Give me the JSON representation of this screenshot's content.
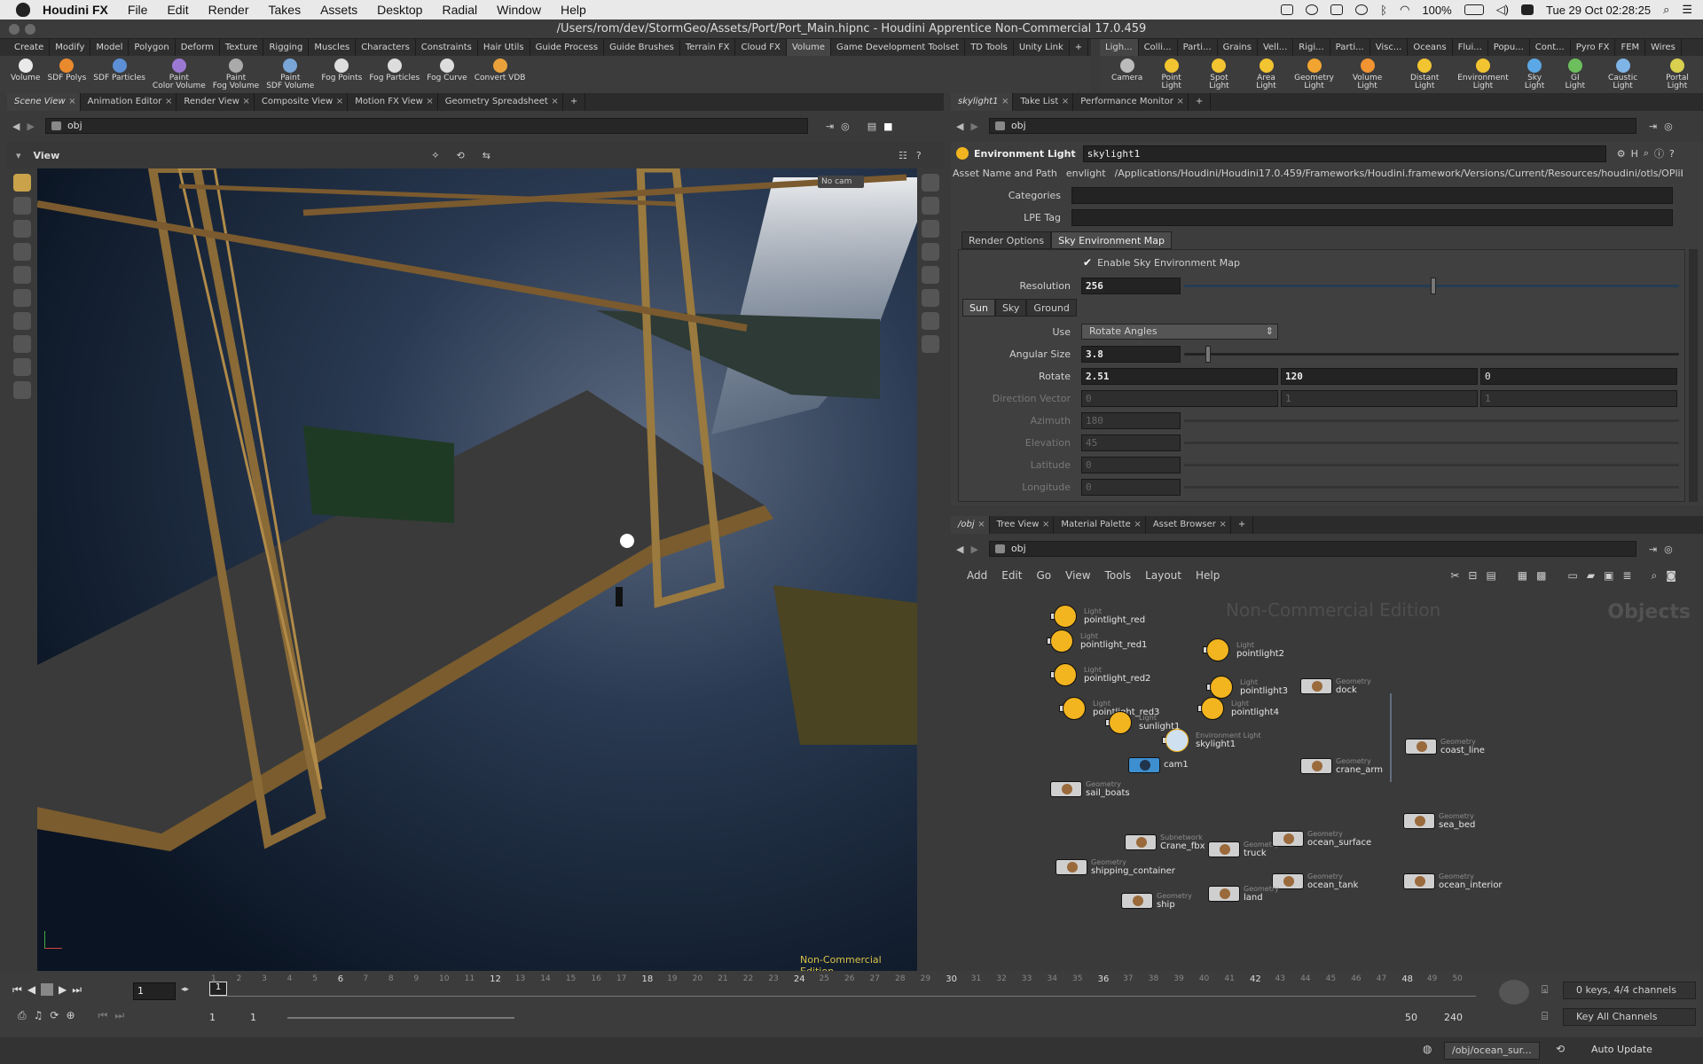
{
  "menubar": {
    "app": "Houdini FX",
    "items": [
      "File",
      "Edit",
      "Render",
      "Takes",
      "Assets",
      "Desktop",
      "Radial",
      "Window",
      "Help"
    ],
    "battery": "100%",
    "datetime": "Tue 29 Oct  02:28:25"
  },
  "window": {
    "title": "/Users/rom/dev/StormGeo/Assets/Port/Port_Main.hipnc - Houdini Apprentice Non-Commercial 17.0.459"
  },
  "shelf": {
    "tabs": [
      "Create",
      "Modify",
      "Model",
      "Polygon",
      "Deform",
      "Texture",
      "Rigging",
      "Muscles",
      "Characters",
      "Constraints",
      "Hair Utils",
      "Guide Process",
      "Guide Brushes",
      "Terrain FX",
      "Cloud FX",
      "Volume",
      "Game Development Toolset",
      "TD Tools",
      "Unity Link",
      "+"
    ],
    "active_tab": "Volume",
    "tools": [
      {
        "label": "Volume",
        "color": "#e9e9e9"
      },
      {
        "label": "SDF Polys",
        "color": "#e98a2e"
      },
      {
        "label": "SDF Particles",
        "color": "#5c8fd6"
      },
      {
        "label": "Paint\nColor Volume",
        "color": "#9b79d3"
      },
      {
        "label": "Paint\nFog Volume",
        "color": "#aaaaaa"
      },
      {
        "label": "Paint\nSDF Volume",
        "color": "#79a6d6"
      },
      {
        "label": "Fog Points",
        "color": "#dddddd"
      },
      {
        "label": "Fog Particles",
        "color": "#dddddd"
      },
      {
        "label": "Fog Curve",
        "color": "#dddddd"
      },
      {
        "label": "Convert VDB",
        "color": "#e9a23b"
      }
    ]
  },
  "light_shelf": {
    "tabs": [
      "Ligh...",
      "Colli...",
      "Parti...",
      "Grains",
      "Vell...",
      "Rigi...",
      "Parti...",
      "Visc...",
      "Oceans",
      "Flui...",
      "Popu...",
      "Cont...",
      "Pyro FX",
      "FEM",
      "Wires"
    ],
    "tools": [
      {
        "label": "Camera",
        "color": "#bbbbbb"
      },
      {
        "label": "Point Light",
        "color": "#f2c431"
      },
      {
        "label": "Spot Light",
        "color": "#f2c431"
      },
      {
        "label": "Area Light",
        "color": "#f2c431"
      },
      {
        "label": "Geometry\nLight",
        "color": "#f2a431"
      },
      {
        "label": "Volume Light",
        "color": "#f29431"
      },
      {
        "label": "Distant Light",
        "color": "#f2c431"
      },
      {
        "label": "Environment\nLight",
        "color": "#f2c431"
      },
      {
        "label": "Sky Light",
        "color": "#5ca8e6"
      },
      {
        "label": "GI Light",
        "color": "#6cbf5c"
      },
      {
        "label": "Caustic Light",
        "color": "#7fb4e6"
      },
      {
        "label": "Portal Light",
        "color": "#d8d04e"
      }
    ]
  },
  "left_pane": {
    "tabs": [
      "Scene View",
      "Animation Editor",
      "Render View",
      "Composite View",
      "Motion FX View",
      "Geometry Spreadsheet",
      "+"
    ],
    "path": "obj",
    "view_label": "View",
    "camera_menu": "No cam",
    "watermark": "Non-Commercial Edition"
  },
  "params_pane": {
    "tabs": [
      "skylight1",
      "Take List",
      "Performance Monitor",
      "+"
    ],
    "path": "obj",
    "node_type": "Environment Light",
    "node_name": "skylight1",
    "asset_label": "Asset Name and Path",
    "asset_name": "envlight",
    "asset_path": "/Applications/Houdini/Houdini17.0.459/Frameworks/Houdini.framework/Versions/Current/Resources/houdini/otls/OPlibObject.hda",
    "categories_label": "Categories",
    "lpe_label": "LPE Tag",
    "section_tabs": [
      "Render Options",
      "Sky Environment Map"
    ],
    "enable_label": "Enable Sky Environment Map",
    "resolution_label": "Resolution",
    "resolution": "256",
    "sub_tabs": [
      "Sun",
      "Sky",
      "Ground"
    ],
    "use_label": "Use",
    "use_value": "Rotate Angles",
    "angular_size_label": "Angular Size",
    "angular_size": "3.8",
    "rotate_label": "Rotate",
    "rotate": [
      "2.51",
      "120",
      "0"
    ],
    "direction_label": "Direction Vector",
    "direction": [
      "0",
      "1",
      "1"
    ],
    "azimuth_label": "Azimuth",
    "azimuth": "180",
    "elevation_label": "Elevation",
    "elevation": "45",
    "latitude_label": "Latitude",
    "latitude": "0",
    "longitude_label": "Longitude",
    "longitude": "0"
  },
  "network_pane": {
    "tabs": [
      "/obj",
      "Tree View",
      "Material Palette",
      "Asset Browser",
      "+"
    ],
    "path": "obj",
    "menu": [
      "Add",
      "Edit",
      "Go",
      "View",
      "Tools",
      "Layout",
      "Help"
    ],
    "watermark": "Non-Commercial Edition",
    "context_label": "Objects",
    "nodes": [
      {
        "type": "Light",
        "name": "pointlight_red",
        "kind": "light"
      },
      {
        "type": "Light",
        "name": "pointlight_red1",
        "kind": "light"
      },
      {
        "type": "Light",
        "name": "pointlight2",
        "kind": "light"
      },
      {
        "type": "Light",
        "name": "pointlight_red2",
        "kind": "light"
      },
      {
        "type": "Light",
        "name": "pointlight3",
        "kind": "light"
      },
      {
        "type": "Geometry",
        "name": "dock",
        "kind": "geo"
      },
      {
        "type": "Light",
        "name": "pointlight_red3",
        "kind": "light"
      },
      {
        "type": "Light",
        "name": "pointlight4",
        "kind": "light"
      },
      {
        "type": "Light",
        "name": "sunlight1",
        "kind": "light"
      },
      {
        "type": "Environment Light",
        "name": "skylight1",
        "kind": "light"
      },
      {
        "type": "Geometry",
        "name": "coast_line",
        "kind": "geo"
      },
      {
        "type": "",
        "name": "cam1",
        "kind": "cam"
      },
      {
        "type": "Geometry",
        "name": "crane_arm",
        "kind": "geo"
      },
      {
        "type": "Geometry",
        "name": "sail_boats",
        "kind": "geo"
      },
      {
        "type": "Geometry",
        "name": "sea_bed",
        "kind": "geo"
      },
      {
        "type": "Subnetwork",
        "name": "Crane_fbx",
        "kind": "geo"
      },
      {
        "type": "Geometry",
        "name": "truck",
        "kind": "geo"
      },
      {
        "type": "Geometry",
        "name": "ocean_surface",
        "kind": "geo"
      },
      {
        "type": "Geometry",
        "name": "shipping_container",
        "kind": "geo"
      },
      {
        "type": "Geometry",
        "name": "ocean_tank",
        "kind": "geo"
      },
      {
        "type": "Geometry",
        "name": "ocean_interior",
        "kind": "geo"
      },
      {
        "type": "Geometry",
        "name": "land",
        "kind": "geo"
      },
      {
        "type": "Geometry",
        "name": "ship",
        "kind": "geo"
      }
    ]
  },
  "timeline": {
    "frame": "1",
    "ticks": [
      "1",
      "2",
      "3",
      "4",
      "5",
      "6",
      "7",
      "8",
      "9",
      "10",
      "11",
      "12",
      "13",
      "14",
      "15",
      "16",
      "17",
      "18",
      "19",
      "20",
      "21",
      "22",
      "23",
      "24",
      "25",
      "26",
      "27",
      "28",
      "29",
      "30",
      "31",
      "32",
      "33",
      "34",
      "35",
      "36",
      "37",
      "38",
      "39",
      "40",
      "41",
      "42",
      "43",
      "44",
      "45",
      "46",
      "47",
      "48",
      "49",
      "50"
    ],
    "range_start": "1",
    "range_start2": "1",
    "range_end": "50",
    "range_end2": "240",
    "keys_label": "0 keys, 4/4 channels",
    "key_all": "Key All Channels",
    "status_path": "/obj/ocean_sur...",
    "auto_update": "Auto Update"
  }
}
